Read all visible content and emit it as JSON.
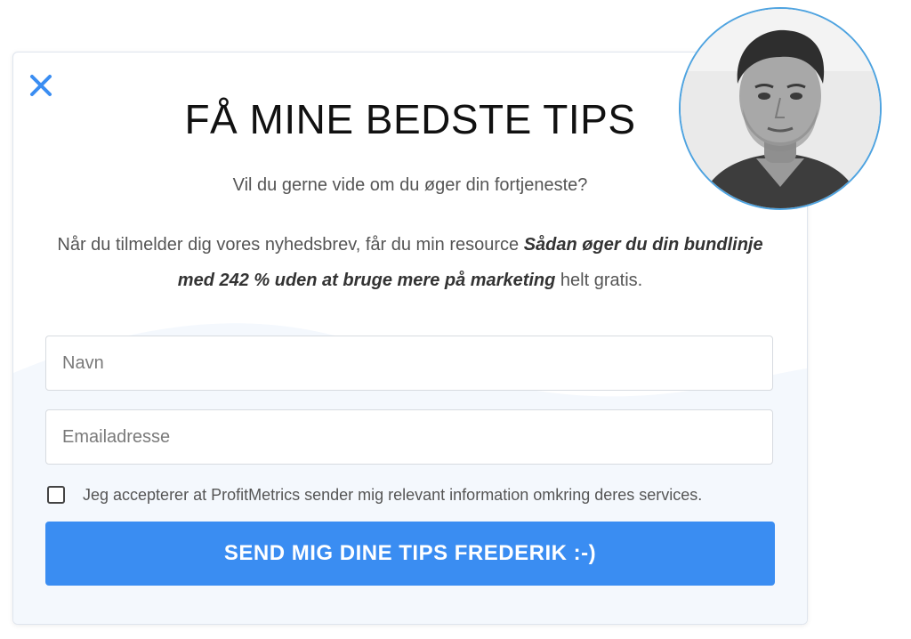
{
  "modal": {
    "title": "FÅ MINE BEDSTE TIPS",
    "subtitle": "Vil du gerne vide om du øger din fortjeneste?",
    "description_before": "Når du tilmelder dig vores nyhedsbrev, får du min resource ",
    "description_bold": "Sådan øger du din bundlinje med 242 % uden at bruge mere på marketing",
    "description_after": " helt gratis.",
    "close_icon": "close-icon",
    "accent_color": "#3a8df2",
    "avatar_icon": "profile-photo"
  },
  "form": {
    "name_placeholder": "Navn",
    "email_placeholder": "Emailadresse",
    "consent_label": "Jeg accepterer at ProfitMetrics sender mig relevant information omkring deres services.",
    "consent_checked": false,
    "submit_label": "SEND MIG DINE TIPS FREDERIK :-)"
  }
}
